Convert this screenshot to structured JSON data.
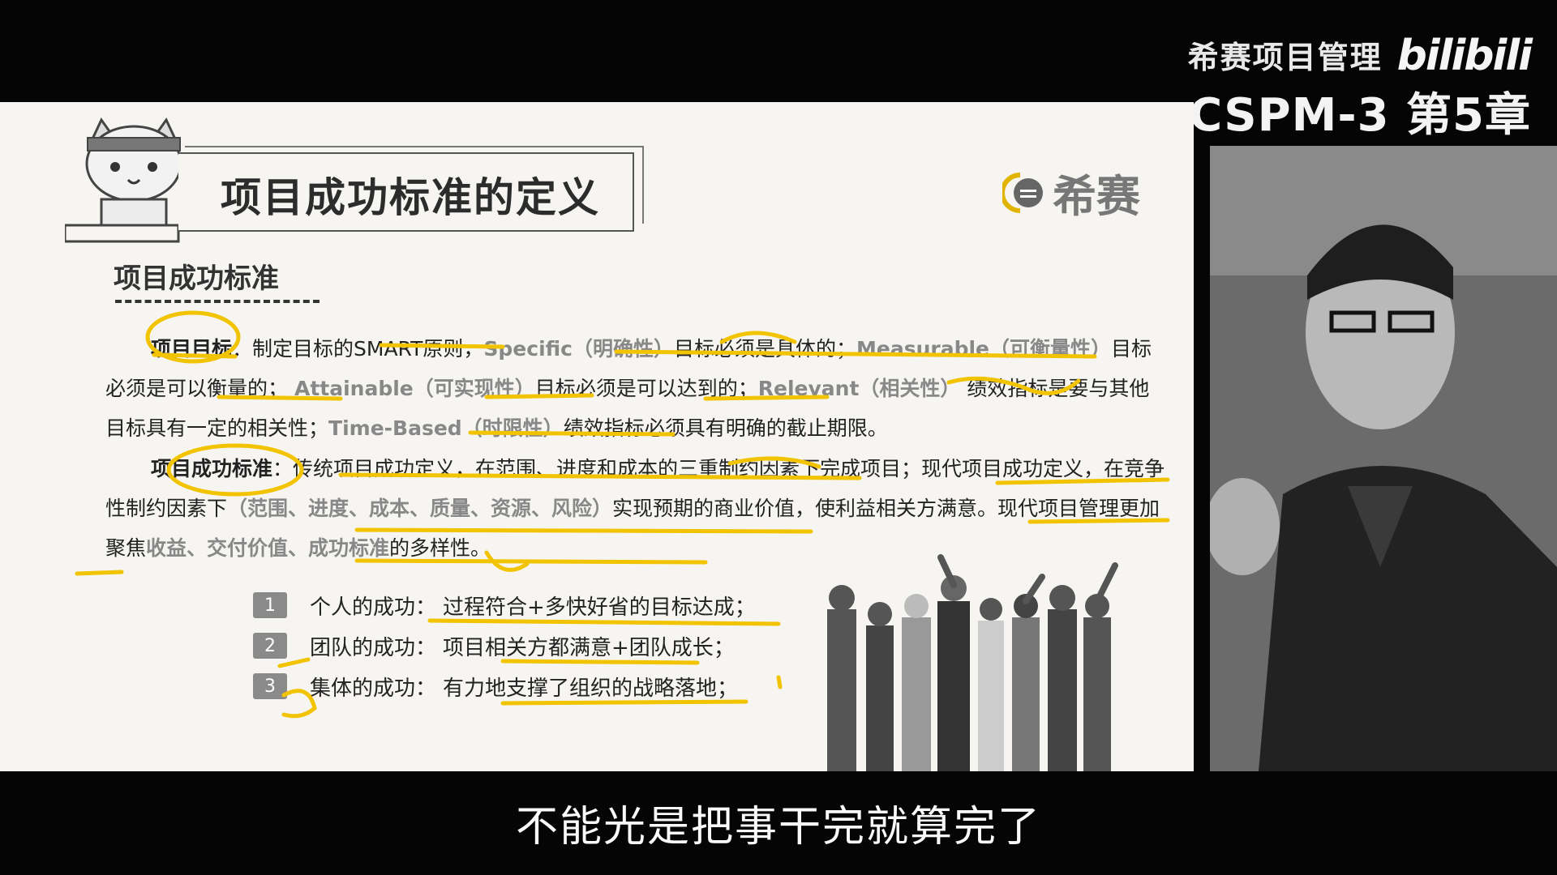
{
  "channel": {
    "name": "希赛项目管理",
    "logo": "bilibili",
    "episode": "CSPM-3 第5章"
  },
  "slide": {
    "title": "项目成功标准的定义",
    "brand": "希赛",
    "section_heading": "项目成功标准",
    "para1": {
      "label": "项目目标",
      "t1": "：制定目标的SMART原则，",
      "s1": "Specific（明确性）",
      "t2": "目标必须是具体的；",
      "s2": "Measurable（可衡量性）",
      "t3": "目标必须是可以衡量的；",
      "s3": "Attainable（可实现性）",
      "t4": "目标必须是可以达到的；",
      "s4": "Relevant（相关性）",
      "t5": "绩效指标是要与其他目标具有一定的相关性；",
      "s5": "Time-Based（时限性）",
      "t6": "绩效指标必须具有明确的截止期限。"
    },
    "para2": {
      "label": "项目成功标准",
      "t1": "：传统项目成功定义，在范围、进度和成本的三重制约因素下完成项目；现代项目成功定义，在竞争性制约因素下",
      "s1": "（范围、进度、成本、质量、资源、风险）",
      "t2": "实现预期的商业价值，使利益相关方满意。现代项目管理更加聚焦",
      "s2": "收益、交付价值、成功标准",
      "t3": "的多样性。"
    },
    "list": [
      {
        "num": "1",
        "label": "个人的成功：",
        "text": "过程符合+多快好省的目标达成；"
      },
      {
        "num": "2",
        "label": "团队的成功：",
        "text": "项目相关方都满意+团队成长；"
      },
      {
        "num": "3",
        "label": "集体的成功：",
        "text": "有力地支撑了组织的战略落地；"
      }
    ]
  },
  "subtitle": "不能光是把事干完就算完了",
  "colors": {
    "highlight": "#f2c300",
    "grey_text": "#888888",
    "background": "#050505"
  }
}
